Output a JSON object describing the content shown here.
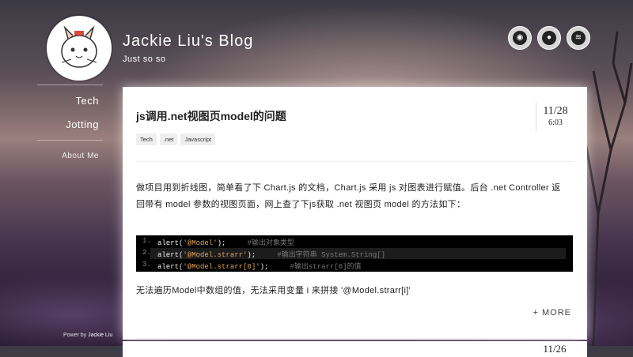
{
  "site": {
    "title": "Jackie Liu's Blog",
    "subtitle": "Just so so"
  },
  "social": [
    {
      "icon": "weibo-icon",
      "glyph": "◉"
    },
    {
      "icon": "github-icon",
      "glyph": "●"
    },
    {
      "icon": "rss-icon",
      "glyph": "≋"
    }
  ],
  "nav": {
    "items": [
      "Tech",
      "Jotting"
    ],
    "about": "About Me"
  },
  "footer": {
    "powered_prefix": "Power by",
    "powered_name": "Jackie Liu"
  },
  "post": {
    "title": "js调用.net视图页model的问题",
    "tags": [
      ".net",
      "Javascript"
    ],
    "tag_first": "Tech",
    "date": {
      "month_day": "11/28",
      "time": "6:03"
    },
    "intro": "做项目用到折线图，简单看了下 Chart.js 的文档，Chart.js 采用 js 对图表进行赋值。后台 .net Controller 返回带有 model 参数的视图页面，网上查了下js获取 .net 视图页 model 的方法如下：",
    "code": {
      "line1_num": "1.",
      "line1_a": "alert(",
      "line1_str": "'@Model'",
      "line1_b": ");",
      "line1_comment": "#输出对象类型",
      "line2_num": "2.",
      "line2_a": "alert(",
      "line2_str": "'@Model.strarr'",
      "line2_b": ");",
      "line2_comment": "#输出字符串 System.String[]",
      "line3_num": "3.",
      "line3_a": "alert(",
      "line3_str": "'@Model.strarr[0]'",
      "line3_b": ");",
      "line3_comment": "#输出strarr[0]的值"
    },
    "outro": "无法遍历Model中数组的值，无法采用变量 i 来拼接 '@Model.strarr[i]'",
    "more": "+ MORE"
  },
  "next_post": {
    "date": "11/26"
  }
}
